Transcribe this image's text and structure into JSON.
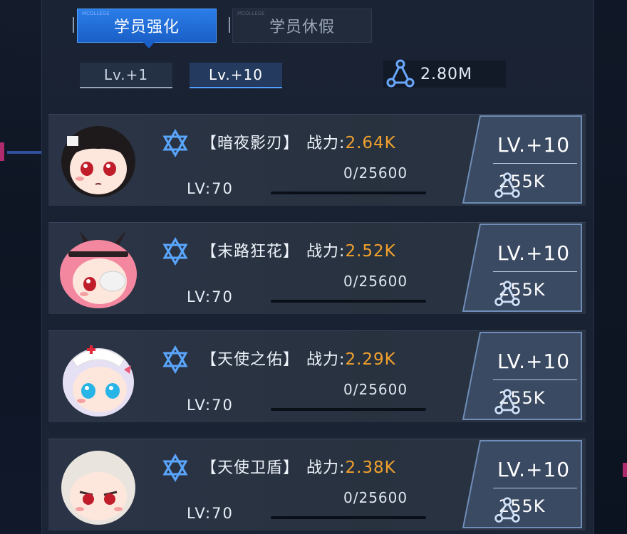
{
  "tabs": [
    {
      "label": "学员强化",
      "tag": "MCOLLEGE",
      "active": true
    },
    {
      "label": "学员休假",
      "tag": "MCOLLEGE",
      "active": false
    }
  ],
  "level_options": [
    {
      "label": "Lv.+1",
      "selected": false
    },
    {
      "label": "Lv.+10",
      "selected": true
    }
  ],
  "currency": {
    "icon": "triangle-nodes-icon",
    "value": "2.80M"
  },
  "colors": {
    "accent": "#2b7de8",
    "power": "#f2a12c",
    "panel": "#1a2334"
  },
  "students": [
    {
      "name": "【暗夜影刃】",
      "power_label": "战力:",
      "power": "2.64K",
      "exp": "0/25600",
      "level": "LV:70",
      "exp_fraction": 0,
      "upgrade_label": "LV.+10",
      "upgrade_cost": "255K",
      "avatar": "black-hair-girl-avatar"
    },
    {
      "name": "【末路狂花】",
      "power_label": "战力:",
      "power": "2.52K",
      "exp": "0/25600",
      "level": "LV:70",
      "exp_fraction": 0,
      "upgrade_label": "LV.+10",
      "upgrade_cost": "255K",
      "avatar": "pink-hair-bunny-girl-avatar"
    },
    {
      "name": "【天使之佑】",
      "power_label": "战力:",
      "power": "2.29K",
      "exp": "0/25600",
      "level": "LV:70",
      "exp_fraction": 0,
      "upgrade_label": "LV.+10",
      "upgrade_cost": "255K",
      "avatar": "nurse-girl-avatar"
    },
    {
      "name": "【天使卫盾】",
      "power_label": "战力:",
      "power": "2.38K",
      "exp": "0/25600",
      "level": "LV:70",
      "exp_fraction": 0,
      "upgrade_label": "LV.+10",
      "upgrade_cost": "255K",
      "avatar": "white-hair-girl-avatar"
    }
  ]
}
